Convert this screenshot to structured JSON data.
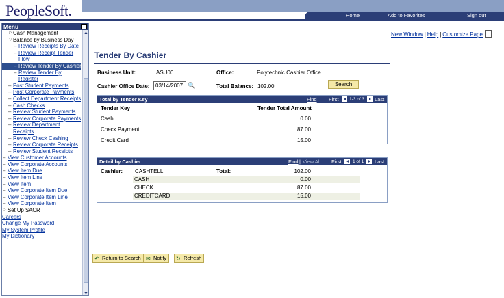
{
  "header": {
    "logo": "PeopleSoft.",
    "links": [
      "Home",
      "Add to Favorites",
      "Sign out"
    ]
  },
  "sidebar": {
    "title": "Menu",
    "items": [
      {
        "label": "Cash Management",
        "level": 1,
        "link": false,
        "tri": "right"
      },
      {
        "label": "Balance by Business Day",
        "level": 1,
        "link": false,
        "tri": "down"
      },
      {
        "label": "Review Receipts By Date",
        "level": 2,
        "link": true
      },
      {
        "label": "Review Receipt Tender Flow",
        "level": 2,
        "link": true
      },
      {
        "label": "Review Tender By Cashier",
        "level": 2,
        "link": true,
        "selected": true
      },
      {
        "label": "Review Tender By Register",
        "level": 2,
        "link": true
      },
      {
        "label": "Post Student Payments",
        "level": 3,
        "link": true
      },
      {
        "label": "Post Corporate Payments",
        "level": 3,
        "link": true
      },
      {
        "label": "Collect Department Receipts",
        "level": 3,
        "link": true
      },
      {
        "label": "Cash Checks",
        "level": 3,
        "link": true
      },
      {
        "label": "Review Student Payments",
        "level": 3,
        "link": true
      },
      {
        "label": "Review Corporate Payments",
        "level": 3,
        "link": true
      },
      {
        "label": "Review Department Receipts",
        "level": 3,
        "link": true
      },
      {
        "label": "Review Check Cashing",
        "level": 3,
        "link": true
      },
      {
        "label": "Review Corporate Receipts",
        "level": 3,
        "link": true
      },
      {
        "label": "Review Student Receipts",
        "level": 3,
        "link": true
      },
      {
        "label": "View Customer Accounts",
        "level": 4,
        "link": true
      },
      {
        "label": "View Corporate Accounts",
        "level": 4,
        "link": true
      },
      {
        "label": "View Item Due",
        "level": 4,
        "link": true
      },
      {
        "label": "View Item Line",
        "level": 4,
        "link": true
      },
      {
        "label": "View Item",
        "level": 4,
        "link": true
      },
      {
        "label": "View Corporate Item Due",
        "level": 4,
        "link": true
      },
      {
        "label": "View Corporate Item Line",
        "level": 4,
        "link": true
      },
      {
        "label": "View Corporate Item",
        "level": 4,
        "link": true
      },
      {
        "label": "Set Up SACR",
        "level": 5,
        "link": false,
        "tri": "right"
      },
      {
        "label": "Careers",
        "level": 6,
        "link": true
      },
      {
        "label": "Change My Password",
        "level": 6,
        "link": true
      },
      {
        "label": "My System Profile",
        "level": 6,
        "link": true
      },
      {
        "label": "My Dictionary",
        "level": 6,
        "link": true
      }
    ]
  },
  "toplinks": {
    "new_window": "New Window",
    "help": "Help",
    "customize": "Customize Page",
    "sep": "|"
  },
  "page": {
    "title": "Tender By Cashier"
  },
  "form": {
    "bu_label": "Business Unit:",
    "bu_value": "ASU00",
    "office_label": "Office:",
    "office_value": "Polytechnic Cashier Office",
    "date_label": "Cashier Office Date:",
    "date_value": "03/14/2007",
    "total_label": "Total Balance:",
    "total_value": "102.00",
    "search": "Search"
  },
  "tender_grid": {
    "title": "Total by Tender Key",
    "find": "Find",
    "first": "First",
    "range": "1-3 of 3",
    "last": "Last",
    "col_key": "Tender Key",
    "col_amt": "Tender Total Amount",
    "rows": [
      {
        "key": "Cash",
        "amount": "0.00"
      },
      {
        "key": "Check Payment",
        "amount": "87.00"
      },
      {
        "key": "Credit Card",
        "amount": "15.00"
      }
    ]
  },
  "detail_grid": {
    "title": "Detail by Cashier",
    "find": "Find",
    "view_all": "View All",
    "first": "First",
    "range": "1 of 1",
    "last": "Last",
    "cashier_label": "Cashier:",
    "cashier_value": "CASHTELL",
    "total_label": "Total:",
    "total_value": "102.00",
    "rows": [
      {
        "name": "CASH",
        "amount": "0.00"
      },
      {
        "name": "CHECK",
        "amount": "87.00"
      },
      {
        "name": "CREDITCARD",
        "amount": "15.00"
      }
    ]
  },
  "actions": {
    "return": "Return to Search",
    "notify": "Notify",
    "refresh": "Refresh"
  }
}
